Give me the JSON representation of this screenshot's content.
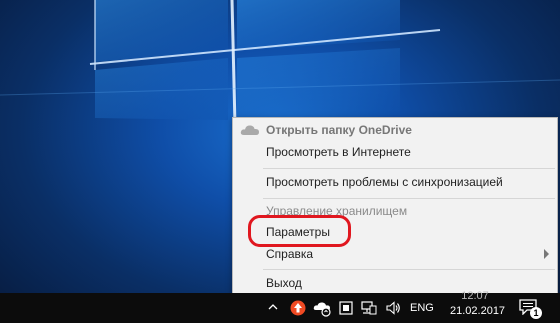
{
  "menu": {
    "items": [
      {
        "label": "Открыть папку OneDrive"
      },
      {
        "label": "Просмотреть в Интернете"
      },
      {
        "label": "Просмотреть проблемы с синхронизацией"
      },
      {
        "label": "Управление хранилищем"
      },
      {
        "label": "Параметры"
      },
      {
        "label": "Справка"
      },
      {
        "label": "Выход"
      }
    ]
  },
  "taskbar": {
    "language": "ENG",
    "time": "12:07",
    "date": "21.02.2017",
    "notification_count": "1"
  },
  "colors": {
    "highlight_ring": "#e0171f",
    "menu_bg": "#f2f2f2",
    "taskbar_bg": "#0c0c0c"
  }
}
